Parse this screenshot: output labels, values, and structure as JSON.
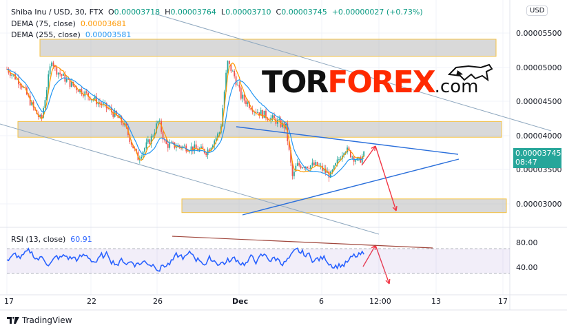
{
  "header": {
    "symbol": "Shiba Inu / USD, 30, FTX",
    "open_label": "O",
    "open": "0.00003718",
    "high_label": "H",
    "high": "0.00003764",
    "low_label": "L",
    "low": "0.00003710",
    "close_label": "C",
    "close": "0.00003745",
    "change": "+0.00000027 (+0.73%)"
  },
  "indicators": [
    {
      "label": "DEMA (75, close)",
      "value": "0.00003681",
      "color": "#ff9800"
    },
    {
      "label": "DEMA (255, close)",
      "value": "0.00003581",
      "color": "#2196f3"
    }
  ],
  "rsi": {
    "label": "RSI (13, close)",
    "value": "60.91",
    "color": "#2962ff",
    "ticks": [
      "80.00",
      "40.00"
    ]
  },
  "price_axis": {
    "currency": "USD",
    "ticks": [
      "0.00005500",
      "0.00005000",
      "0.00004500",
      "0.00004000",
      "0.00003500",
      "0.00003000"
    ],
    "current_price": "0.00003745",
    "countdown": "08:47",
    "current_color": "#26a69a"
  },
  "time_axis": {
    "ticks": [
      "17",
      "22",
      "26",
      "Dec",
      "6",
      "12:00",
      "13",
      "17"
    ]
  },
  "watermark": {
    "part1": "TOR",
    "part2": "FOREX",
    "part3": ".com"
  },
  "footer": {
    "brand": "TradingView"
  },
  "chart_data": {
    "type": "candlestick",
    "unit": "1e-5 USD",
    "price_path_days_from_nov17": [
      [
        0,
        4.977
      ],
      [
        0.83,
        4.776
      ],
      [
        1.66,
        4.374
      ],
      [
        2.07,
        4.224
      ],
      [
        2.7,
        5.128
      ],
      [
        2.9,
        4.977
      ],
      [
        3.73,
        4.776
      ],
      [
        4.98,
        4.575
      ],
      [
        6.22,
        4.374
      ],
      [
        7.05,
        4.173
      ],
      [
        7.88,
        3.671
      ],
      [
        8.71,
        3.972
      ],
      [
        9.13,
        4.224
      ],
      [
        9.54,
        3.872
      ],
      [
        11.2,
        3.822
      ],
      [
        12.03,
        3.771
      ],
      [
        12.86,
        4.073
      ],
      [
        13.28,
        5.078
      ],
      [
        13.69,
        4.877
      ],
      [
        14.1,
        4.575
      ],
      [
        14.94,
        4.374
      ],
      [
        16.18,
        4.224
      ],
      [
        16.8,
        4.123
      ],
      [
        17.22,
        3.369
      ],
      [
        17.43,
        3.57
      ],
      [
        18.67,
        3.57
      ],
      [
        19.5,
        3.42
      ],
      [
        20.33,
        3.822
      ],
      [
        21.16,
        3.621
      ],
      [
        21.58,
        3.745
      ]
    ],
    "zones": [
      [
        5.16,
        5.41
      ],
      [
        3.98,
        4.21
      ],
      [
        2.88,
        3.08
      ]
    ]
  }
}
